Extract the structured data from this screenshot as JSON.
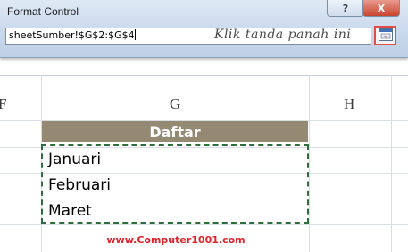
{
  "dialog": {
    "title": "Format Control",
    "help_label": "?",
    "close_label": "X",
    "range_value": "sheetSumber!$G$2:$G$4",
    "annotation": "Klik tanda panah ini"
  },
  "sheet": {
    "column_headers": [
      "F",
      "G",
      "H"
    ],
    "header_cell": "Daftar",
    "items": [
      "Januari",
      "Februari",
      "Maret"
    ]
  },
  "watermark": "www.Computer1001.com",
  "colors": {
    "header_fill": "#948a74",
    "selection_border": "#2e6e3c",
    "annotation_box": "#e34a4a",
    "watermark": "#e0222a"
  }
}
